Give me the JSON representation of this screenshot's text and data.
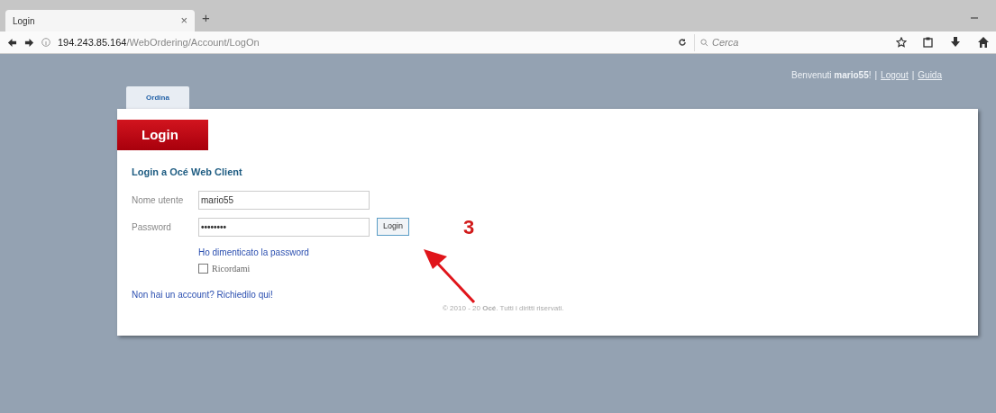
{
  "browser": {
    "tab_title": "Login",
    "new_tab": "+",
    "close_tab": "×",
    "url_host": "194.243.85.164",
    "url_path": "/WebOrdering/Account/LogOn",
    "search_placeholder": "Cerca"
  },
  "header": {
    "welcome": "Benvenuti **mario55**!",
    "links": [
      {
        "label": "Logout"
      },
      {
        "label": "Guida"
      }
    ],
    "separator": "|"
  },
  "nav_tabs": [
    {
      "label": "Ordina",
      "selected": true
    }
  ],
  "login": {
    "banner": "Login",
    "heading": "Login a Océ Web Client",
    "username_label": "Nome utente",
    "username_value": "mario55",
    "password_label": "Password",
    "password_mask": "••••••••",
    "button": "Login",
    "forgot": "Ho dimenticato la password",
    "remember": {
      "label": "Ricordami",
      "checked": false
    },
    "request": "Non hai un account? Richiedilo qui!"
  },
  "footer": "© 2010 - 20 **Océ**. Tutti i diritti riservati.",
  "annotation": {
    "number": "3"
  }
}
